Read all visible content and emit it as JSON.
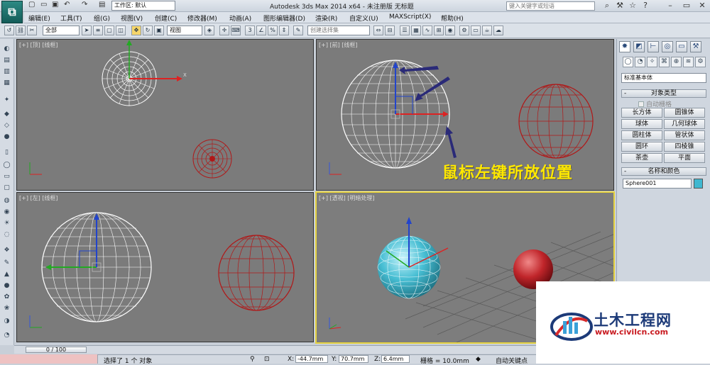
{
  "titlebar": {
    "app_icon": "3ds-max-logo",
    "workspace_label": "工作区: 默认",
    "app_title": "Autodesk 3ds Max  2014 x64  -  未注册版   无标题",
    "search_placeholder": "键入关键字或短语"
  },
  "menu": [
    "编辑(E)",
    "工具(T)",
    "组(G)",
    "视图(V)",
    "创建(C)",
    "修改器(M)",
    "动画(A)",
    "图形编辑器(D)",
    "渲染(R)",
    "自定义(U)",
    "MAXScript(X)",
    "帮助(H)"
  ],
  "toolbar": {
    "selection_filter": "全部",
    "coord_system": "视图",
    "named_selection": "创建选择集"
  },
  "viewports": {
    "top": {
      "label": "[+] [顶] [线框]"
    },
    "front": {
      "label": "[+] [前] [线框]"
    },
    "left": {
      "label": "[+] [左] [线框]"
    },
    "perspective": {
      "label": "[+] [透视] [明暗处理]"
    }
  },
  "annotation": "鼠标左键所放位置",
  "command_panel": {
    "category": "标准基本体",
    "object_type_header": "对象类型",
    "auto_grid": "自动栅格",
    "objects": [
      "长方体",
      "圆锥体",
      "球体",
      "几何球体",
      "圆柱体",
      "管状体",
      "圆环",
      "四棱锥",
      "茶壶",
      "平面"
    ],
    "name_color_header": "名称和颜色",
    "object_name": "Sphere001",
    "object_color": "#3fb7d0"
  },
  "timeline": {
    "frame": "0 / 100"
  },
  "status": {
    "message": "选择了 1 个 对象",
    "x_label": "X:",
    "x_value": "-44.7mm",
    "y_label": "Y:",
    "y_value": "70.7mm",
    "z_label": "Z:",
    "z_value": "6.4mm",
    "grid": "栅格 = 10.0mm",
    "autokey": "自动关键点"
  },
  "watermark": {
    "title": "土木工程网",
    "url": "www.civilcn.com"
  }
}
